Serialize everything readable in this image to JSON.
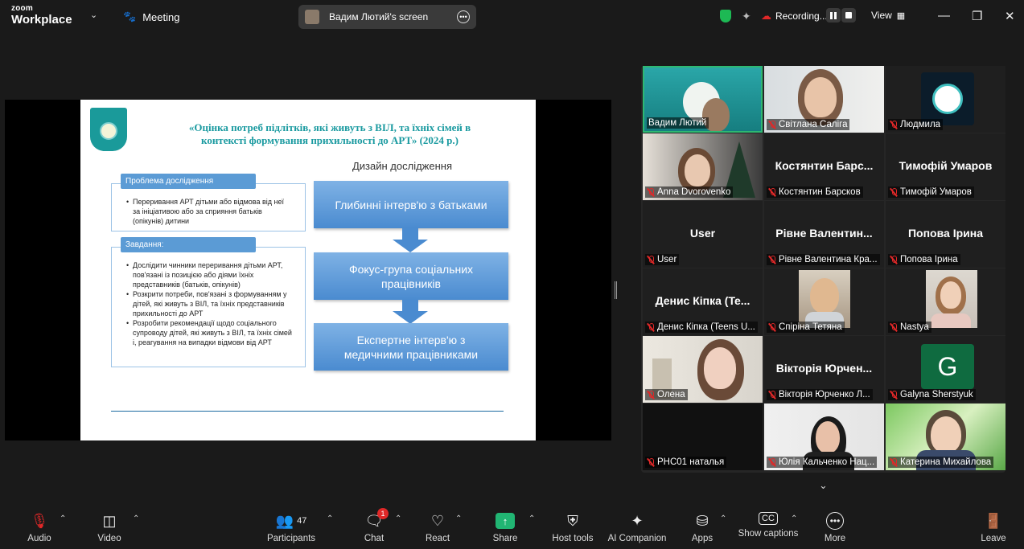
{
  "app": {
    "logo_line1": "zoom",
    "logo_line2": "Workplace",
    "meeting_label": "Meeting"
  },
  "screen_pill": {
    "label": "Вадим Лютий's screen"
  },
  "top_right": {
    "recording_label": "Recording...",
    "view_label": "View"
  },
  "slide": {
    "title": "«Оцінка потреб підлітків, які живуть з ВІЛ, та їхніх сімей в контексті формування прихильності до АРТ» (2024 р.)",
    "design_label": "Дизайн дослідження",
    "problem_head": "Проблема дослідження",
    "problem_bullets": [
      "Переривання АРТ дітьми або відмова від неї за ініціативою або за сприяння батьків (опікунів) дитини"
    ],
    "tasks_head": "Завдання:",
    "tasks_bullets": [
      "Дослідити чинники переривання дітьми АРТ, пов'язані із позицією або діями їхніх представників (батьків, опікунів)",
      "Розкрити потреби, пов'язані з формуванням у дітей, які живуть з ВІЛ, та їхніх представників прихильності до АРТ",
      "Розробити рекомендації щодо соціального супроводу дітей, які живуть з ВІЛ, та їхніх сімей і, реагування на випадки відмови від АРТ"
    ],
    "steps": [
      "Глибинні інтерв'ю з батьками",
      "Фокус-група соціальних працівників",
      "Експертне інтерв'ю з медичними працівниками"
    ]
  },
  "participants": [
    {
      "name": "Вадим Лютий",
      "big": "",
      "muted": false
    },
    {
      "name": "Світлана Саліга",
      "big": "",
      "muted": true
    },
    {
      "name": "Людмила",
      "big": "",
      "muted": true
    },
    {
      "name": "Anna Dvorovenko",
      "big": "",
      "muted": true
    },
    {
      "name": "Костянтин Барсков",
      "big": "Костянтин Барс...",
      "muted": true
    },
    {
      "name": "Тимофій Умаров",
      "big": "Тимофій Умаров",
      "muted": true
    },
    {
      "name": "User",
      "big": "User",
      "muted": true
    },
    {
      "name": "Рівне Валентина Кра...",
      "big": "Рівне Валентин...",
      "muted": true
    },
    {
      "name": "Попова Ірина",
      "big": "Попова Ірина",
      "muted": true
    },
    {
      "name": "Денис Кіпка (Teens U...",
      "big": "Денис Кіпка (Te...",
      "muted": true
    },
    {
      "name": "Спіріна Тетяна",
      "big": "",
      "muted": true
    },
    {
      "name": "Nastya",
      "big": "",
      "muted": true
    },
    {
      "name": "Олена",
      "big": "",
      "muted": true
    },
    {
      "name": "Вікторія Юрченко Л...",
      "big": "Вікторія Юрчен...",
      "muted": true
    },
    {
      "name": "Galyna Sherstyuk",
      "big": "",
      "muted": true,
      "avatar_letter": "G"
    },
    {
      "name": "РНС01 наталья",
      "big": "",
      "muted": true
    },
    {
      "name": "Юлія Кальченко Нац...",
      "big": "",
      "muted": true
    },
    {
      "name": "Катерина Михайлова",
      "big": "",
      "muted": true
    }
  ],
  "toolbar": {
    "audio": "Audio",
    "video": "Video",
    "participants": "Participants",
    "participants_count": "47",
    "chat": "Chat",
    "chat_badge": "1",
    "react": "React",
    "share": "Share",
    "host_tools": "Host tools",
    "ai_companion": "AI Companion",
    "apps": "Apps",
    "show_captions": "Show captions",
    "more": "More",
    "leave": "Leave"
  },
  "colors": {
    "accent_green": "#21b573",
    "mute_red": "#e02828",
    "slide_blue": "#5b9bd5",
    "title_teal": "#1a9aa0"
  }
}
